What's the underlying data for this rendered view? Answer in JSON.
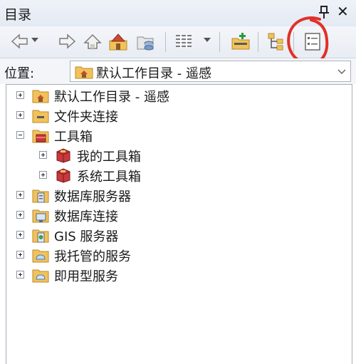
{
  "window": {
    "title": "目录"
  },
  "toolbar": {
    "buttons": [
      "back-icon",
      "forward-icon",
      "up-folder-icon",
      "home-icon",
      "catalog-db-icon",
      "view-details-icon",
      "connect-folder-icon",
      "tree-view-icon",
      "properties-icon"
    ]
  },
  "location": {
    "label": "位置:",
    "value": "默认工作目录 - 遥感"
  },
  "tree": {
    "items": [
      {
        "label": "默认工作目录 - 遥感",
        "expander": "+",
        "icon": "home-folder-icon"
      },
      {
        "label": "文件夹连接",
        "expander": "+",
        "icon": "folder-connection-icon"
      },
      {
        "label": "工具箱",
        "expander": "−",
        "icon": "toolbox-icon"
      },
      {
        "label": "我的工具箱",
        "expander": "+",
        "icon": "toolbox-icon"
      },
      {
        "label": "系统工具箱",
        "expander": "+",
        "icon": "toolbox-icon"
      },
      {
        "label": "数据库服务器",
        "expander": "+",
        "icon": "database-server-icon"
      },
      {
        "label": "数据库连接",
        "expander": "+",
        "icon": "database-connection-icon"
      },
      {
        "label": "GIS 服务器",
        "expander": "+",
        "icon": "gis-server-icon"
      },
      {
        "label": "我托管的服务",
        "expander": "+",
        "icon": "hosted-services-icon"
      },
      {
        "label": "即用型服务",
        "expander": "+",
        "icon": "ready-services-icon"
      }
    ]
  },
  "colors": {
    "annotation": "#e0312a",
    "folder": "#f2c25a",
    "toolbox": "#c8383d",
    "accent": "#2a6fcf"
  }
}
